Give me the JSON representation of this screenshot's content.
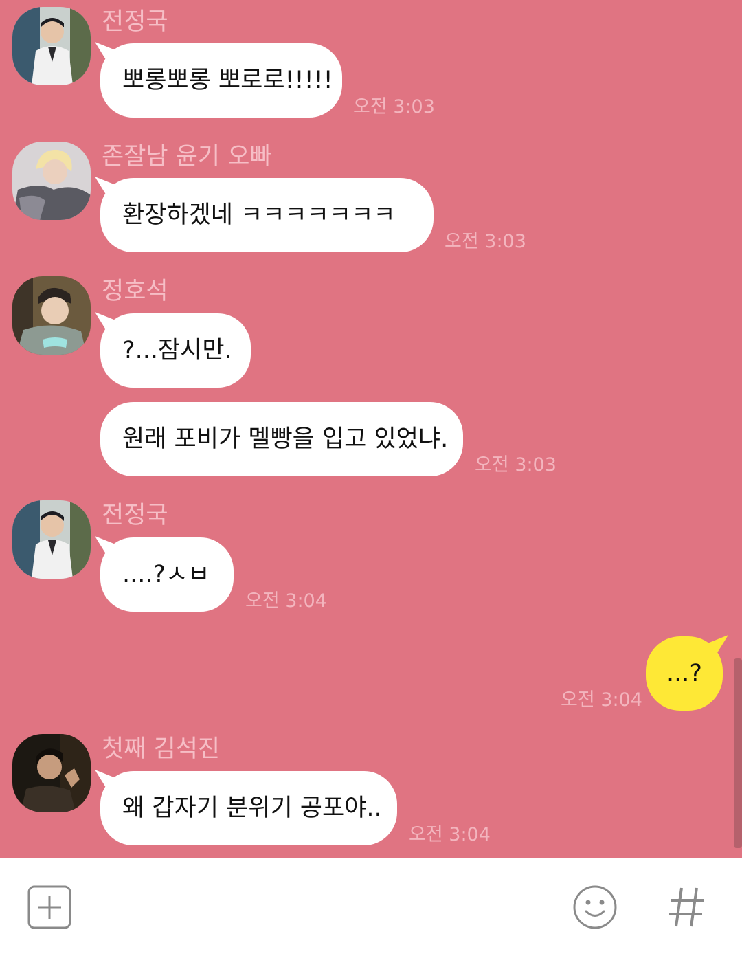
{
  "messages": [
    {
      "sender": "전정국",
      "text": "뽀롱뽀롱 뽀로로!!!!!",
      "time": "오전 3:03"
    },
    {
      "sender": "존잘남 윤기 오빠",
      "text": "환장하겠네 ㅋㅋㅋㅋㅋㅋㅋ",
      "time": "오전 3:03"
    },
    {
      "sender": "정호석",
      "text": "?...잠시만.",
      "text2": "원래 포비가 멜빵을 입고 있었냐.",
      "time": "오전 3:03"
    },
    {
      "sender": "전정국",
      "text": "....?ㅅㅂ",
      "time": "오전 3:04"
    },
    {
      "sender": "",
      "text": "...?",
      "time": "오전 3:04"
    },
    {
      "sender": "첫째 김석진",
      "text": "왜 갑자기 분위기 공포야..",
      "time": "오전 3:04"
    }
  ],
  "colors": {
    "chat_background": "#E07482",
    "own_bubble": "#FEE836",
    "other_bubble": "#FFFFFF",
    "sender_name": "#F6BEC6",
    "timestamp": "#F3B5BE",
    "input_bar": "#FFFFFF"
  },
  "input_bar": {
    "icons": [
      "plus-icon",
      "emoji-smile-icon",
      "hash-icon"
    ]
  }
}
